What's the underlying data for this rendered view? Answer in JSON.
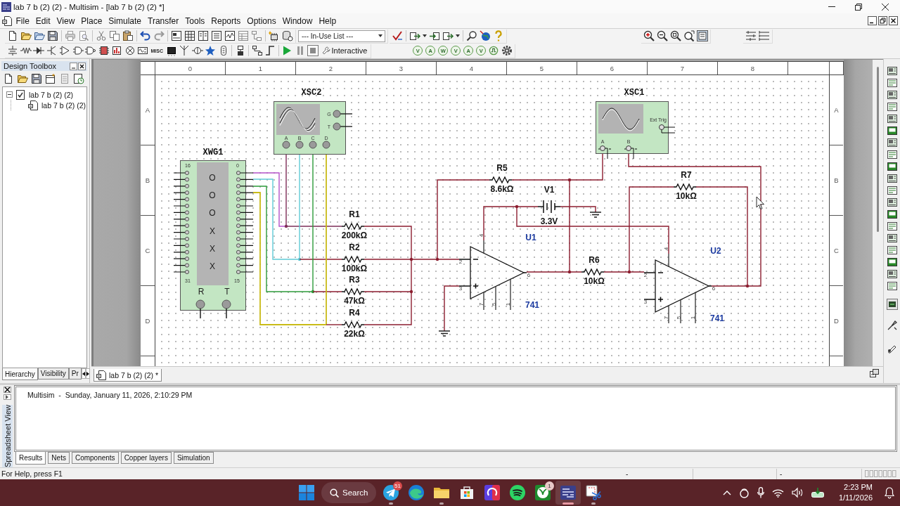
{
  "window": {
    "title": "lab 7 b (2) (2) - Multisim - [lab 7 b (2) (2) *]"
  },
  "menu": [
    "File",
    "Edit",
    "View",
    "Place",
    "Simulate",
    "Transfer",
    "Tools",
    "Reports",
    "Options",
    "Window",
    "Help"
  ],
  "toolbar": {
    "in_use_list": "--- In-Use List ---",
    "misc_button": "MISC",
    "sim_mode": "Interactive",
    "probes": [
      "V",
      "A",
      "W",
      "V",
      "A",
      "V"
    ]
  },
  "design_toolbox": {
    "title": "Design Toolbox",
    "tree": [
      {
        "label": "lab 7 b (2) (2)",
        "expanded": true,
        "selected": false,
        "children": [
          {
            "label": "lab 7 b (2) (2)",
            "selected": false
          }
        ]
      }
    ],
    "tabs": [
      {
        "label": "Hierarchy",
        "selected": true
      },
      {
        "label": "Visibility",
        "selected": false
      },
      {
        "label": "Pr",
        "selected": false
      }
    ]
  },
  "sheet": {
    "column_labels": [
      "0",
      "1",
      "2",
      "3",
      "4",
      "5",
      "6",
      "7",
      "8"
    ],
    "row_labels_left": [
      "A",
      "B",
      "C",
      "D"
    ],
    "row_labels_right": [
      "A",
      "B",
      "C",
      "D"
    ],
    "parts": [
      {
        "kind": "four_channel_oscilloscope",
        "ref": "XSC2",
        "inputs": [
          "A",
          "B",
          "C",
          "D"
        ],
        "side_inputs": [
          "G",
          "T"
        ]
      },
      {
        "kind": "word_generator",
        "ref": "XWG1",
        "pin_labels": [
          "16",
          "0",
          "31",
          "15"
        ],
        "display": [
          "O",
          "O",
          "O",
          "X",
          "X",
          "X"
        ],
        "terminals": [
          "R",
          "T"
        ]
      },
      {
        "kind": "resistor",
        "ref": "R1",
        "value": "200kΩ"
      },
      {
        "kind": "resistor",
        "ref": "R2",
        "value": "100kΩ"
      },
      {
        "kind": "resistor",
        "ref": "R3",
        "value": "47kΩ"
      },
      {
        "kind": "resistor",
        "ref": "R4",
        "value": "22kΩ"
      },
      {
        "kind": "resistor",
        "ref": "R5",
        "value": "8.6kΩ"
      },
      {
        "kind": "battery",
        "ref": "V1",
        "value": "3.3V"
      },
      {
        "kind": "opamp",
        "ref": "U1",
        "model": "741",
        "pins": [
          "4",
          "2",
          "3",
          "6",
          "7",
          "5",
          "1"
        ]
      },
      {
        "kind": "resistor",
        "ref": "R6",
        "value": "10kΩ"
      },
      {
        "kind": "oscilloscope",
        "ref": "XSC1",
        "inputs": [
          "A",
          "B"
        ],
        "trigger": "Ext Trig"
      },
      {
        "kind": "resistor",
        "ref": "R7",
        "value": "10kΩ"
      },
      {
        "kind": "opamp",
        "ref": "U2",
        "model": "741",
        "pins": [
          "4",
          "2",
          "3",
          "6",
          "7",
          "5",
          "1"
        ]
      }
    ]
  },
  "document_tabs": [
    {
      "label": "lab 7 b (2) (2) *",
      "selected": true
    }
  ],
  "spreadsheet": {
    "title": "Spreadsheet View",
    "log": [
      "Multisim  -  Sunday, January 11, 2026, 2:10:29 PM"
    ],
    "tabs": [
      {
        "label": "Results",
        "selected": true
      },
      {
        "label": "Nets",
        "selected": false
      },
      {
        "label": "Components",
        "selected": false
      },
      {
        "label": "Copper layers",
        "selected": false
      },
      {
        "label": "Simulation",
        "selected": false
      }
    ]
  },
  "status_bar": {
    "help": "For Help, press F1",
    "panes": [
      "-",
      "-"
    ]
  },
  "taskbar": {
    "search": "Search",
    "apps": [
      {
        "kind": "plane",
        "badge": "51",
        "running": true,
        "selected": false
      },
      {
        "kind": "browser",
        "running": false,
        "selected": false
      },
      {
        "kind": "folder",
        "running": true,
        "selected": false
      },
      {
        "kind": "store",
        "running": false,
        "selected": false
      },
      {
        "kind": "launcher",
        "running": false,
        "selected": false
      },
      {
        "kind": "music",
        "running": false,
        "selected": false
      },
      {
        "kind": "game",
        "badge": "1",
        "running": false,
        "selected": false
      },
      {
        "kind": "schematic",
        "running": true,
        "selected": true
      },
      {
        "kind": "snip",
        "running": true,
        "selected": false
      }
    ],
    "clock": {
      "time": "2:23 PM",
      "date": "1/11/2026"
    }
  }
}
